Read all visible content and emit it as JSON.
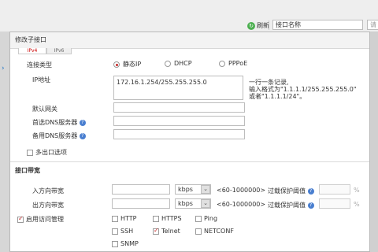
{
  "toolbar": {
    "refresh": "刷新",
    "filter_select": "接口名称",
    "filter_input_placeholder": "请"
  },
  "dialog": {
    "title": "修改子接口",
    "tabs": [
      "IPv4",
      "IPv6"
    ]
  },
  "form": {
    "connection_type_label": "连接类型",
    "radio_static": "静态IP",
    "radio_dhcp": "DHCP",
    "radio_pppoe": "PPPoE",
    "ip_label": "IP地址",
    "ip_value": "172.16.1.254/255.255.255.0",
    "ip_hint_1": "一行一条记录,",
    "ip_hint_2": "输入格式为\"1.1.1.1/255.255.255.0\"",
    "ip_hint_3": "或者\"1.1.1.1/24\"。",
    "gateway_label": "默认网关",
    "dns1_label": "首选DNS服务器",
    "dns2_label": "备用DNS服务器",
    "multi_exit_label": "多出口选项"
  },
  "bandwidth": {
    "section_title": "接口带宽",
    "inbound_label": "入方向带宽",
    "outbound_label": "出方向带宽",
    "unit": "kbps",
    "range": "<60-1000000>",
    "threshold_label": "过载保护阈值",
    "percent": "%"
  },
  "access": {
    "enable_label": "启用访问管理",
    "options": [
      "HTTP",
      "HTTPS",
      "Ping",
      "SSH",
      "Telnet",
      "NETCONF",
      "SNMP"
    ]
  },
  "colors": {
    "accent_red": "#c62828",
    "help_blue": "#4a7fd0",
    "refresh_green": "#4caf50"
  }
}
